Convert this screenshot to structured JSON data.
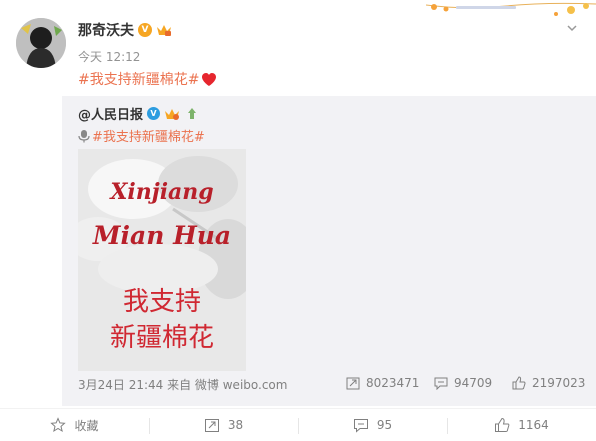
{
  "author": {
    "name": "那奇沃夫",
    "time": "今天 12:12"
  },
  "post": {
    "text": "#我支持新疆棉花#",
    "emoji": "red-heart"
  },
  "repost": {
    "author": "@人民日报",
    "tagline": "#我支持新疆棉花#",
    "image": {
      "line1": "Xinjiang",
      "line2": "Mian Hua",
      "line3": "我支持",
      "line4": "新疆棉花"
    },
    "meta": "3月24日 21:44 来自 微博 weibo.com",
    "stats": {
      "reposts": "8023471",
      "comments": "94709",
      "likes": "2197023"
    }
  },
  "actions": {
    "favorite": "收藏",
    "repost": "38",
    "comment": "95",
    "like": "1164"
  },
  "colors": {
    "hashtag": "#eb7350",
    "repost_bg": "#f2f2f5",
    "muted": "#808080"
  }
}
